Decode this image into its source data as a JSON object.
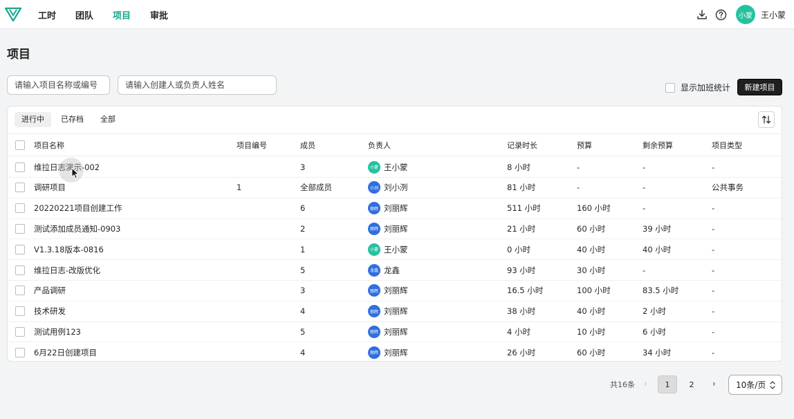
{
  "nav": {
    "items": [
      "工时",
      "团队",
      "项目",
      "审批"
    ],
    "active_index": 2
  },
  "user": {
    "avatar_text": "小蒙",
    "name": "王小蒙"
  },
  "page": {
    "title": "项目"
  },
  "filters": {
    "project_placeholder": "请输入项目名称或编号",
    "person_placeholder": "请输入创建人或负责人姓名",
    "overtime_label": "显示加班统计",
    "new_button": "新建项目"
  },
  "tabs": [
    "进行中",
    "已存档",
    "全部"
  ],
  "table": {
    "headers": {
      "name": "项目名称",
      "code": "项目编号",
      "members": "成员",
      "owner": "负责人",
      "hours": "记录时长",
      "budget": "预算",
      "remaining": "剩余预算",
      "type": "项目类型"
    },
    "rows": [
      {
        "name": "维拉日志演示-002",
        "code": "",
        "members": "3",
        "owner": "王小蒙",
        "owner_avatar": "小蒙",
        "avatar_color": "#25c2a0",
        "hours": "8 小时",
        "budget": "-",
        "remaining": "-",
        "type": "-"
      },
      {
        "name": "调研项目",
        "code": "1",
        "members": "全部成员",
        "owner": "刘小洌",
        "owner_avatar": "小洌",
        "avatar_color": "#2f6fe0",
        "hours": "81 小时",
        "budget": "-",
        "remaining": "-",
        "type": "公共事务"
      },
      {
        "name": "20220221项目创建工作",
        "code": "",
        "members": "6",
        "owner": "刘丽辉",
        "owner_avatar": "丽辉",
        "avatar_color": "#2f6fe0",
        "hours": "511 小时",
        "budget": "160 小时",
        "remaining": "-",
        "type": "-"
      },
      {
        "name": "测试添加成员通知-0903",
        "code": "",
        "members": "2",
        "owner": "刘丽辉",
        "owner_avatar": "丽辉",
        "avatar_color": "#2f6fe0",
        "hours": "21 小时",
        "budget": "60 小时",
        "remaining": "39 小时",
        "type": "-"
      },
      {
        "name": "V1.3.18版本-0816",
        "code": "",
        "members": "1",
        "owner": "王小蒙",
        "owner_avatar": "小蒙",
        "avatar_color": "#25c2a0",
        "hours": "0 小时",
        "budget": "40 小时",
        "remaining": "40 小时",
        "type": "-"
      },
      {
        "name": "维拉日志-改版优化",
        "code": "",
        "members": "5",
        "owner": "龙鑫",
        "owner_avatar": "龙鑫",
        "avatar_color": "#2f6fe0",
        "hours": "93 小时",
        "budget": "30 小时",
        "remaining": "-",
        "type": "-"
      },
      {
        "name": "产品调研",
        "code": "",
        "members": "3",
        "owner": "刘丽辉",
        "owner_avatar": "丽辉",
        "avatar_color": "#2f6fe0",
        "hours": "16.5 小时",
        "budget": "100 小时",
        "remaining": "83.5 小时",
        "type": "-"
      },
      {
        "name": "技术研发",
        "code": "",
        "members": "4",
        "owner": "刘丽辉",
        "owner_avatar": "丽辉",
        "avatar_color": "#2f6fe0",
        "hours": "38 小时",
        "budget": "40 小时",
        "remaining": "2 小时",
        "type": "-"
      },
      {
        "name": "测试用例123",
        "code": "",
        "members": "5",
        "owner": "刘丽辉",
        "owner_avatar": "丽辉",
        "avatar_color": "#2f6fe0",
        "hours": "4 小时",
        "budget": "10 小时",
        "remaining": "6 小时",
        "type": "-"
      },
      {
        "name": "6月22日创建项目",
        "code": "",
        "members": "4",
        "owner": "刘丽辉",
        "owner_avatar": "丽辉",
        "avatar_color": "#2f6fe0",
        "hours": "26 小时",
        "budget": "60 小时",
        "remaining": "34 小时",
        "type": "-"
      }
    ]
  },
  "pagination": {
    "total": "共16条",
    "pages": [
      "1",
      "2"
    ],
    "current": "1",
    "page_size": "10条/页"
  },
  "icons": {
    "logo": "brand-logo-icon",
    "download": "download-icon",
    "help": "help-icon",
    "sort": "sort-icon",
    "prev": "chevron-left-icon",
    "next": "chevron-right-icon",
    "page_size_toggle": "chevron-updown-icon"
  }
}
